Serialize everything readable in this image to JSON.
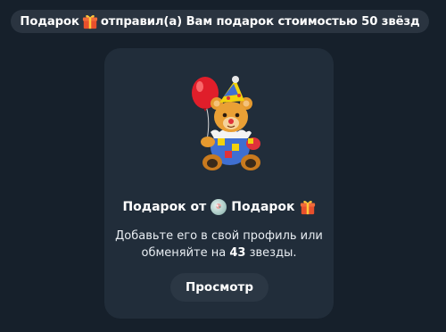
{
  "service_message": {
    "sender": "Подарок",
    "text": "отправил(а) Вам подарок стоимостью 50 звёзд",
    "icons": [
      "gift-icon"
    ]
  },
  "gift_card": {
    "sticker": "teddy-bear-clown-with-balloon",
    "title_prefix": "Подарок от",
    "title_sender": "Подарок",
    "desc_line1": "Добавьте его в свой профиль или",
    "desc_line2_prefix": "обменяйте на",
    "stars": "43",
    "desc_line2_suffix": "звезды.",
    "view_button": "Просмотр"
  },
  "colors": {
    "background": "#16202b",
    "pill": "#2a3440",
    "card": "#212d3a",
    "button": "#2b3744",
    "text": "#ffffff"
  }
}
